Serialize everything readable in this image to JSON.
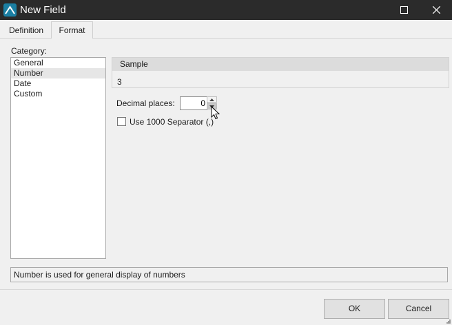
{
  "window": {
    "title": "New Field",
    "app_icon": "app-logo-icon",
    "maximize_icon": "maximize-icon",
    "close_icon": "close-icon"
  },
  "tabs": [
    {
      "label": "Definition",
      "active": false
    },
    {
      "label": "Format",
      "active": true
    }
  ],
  "category": {
    "label": "Category:",
    "items": [
      "General",
      "Number",
      "Date",
      "Custom"
    ],
    "selected": "Number"
  },
  "sample": {
    "header": "Sample",
    "value": "3"
  },
  "decimal_places": {
    "label": "Decimal places:",
    "value": "0"
  },
  "separator": {
    "label": "Use 1000 Separator (,)",
    "checked": false
  },
  "description": "Number is used for general display of numbers",
  "buttons": {
    "ok": "OK",
    "cancel": "Cancel"
  },
  "colors": {
    "titlebar": "#2b2b2b",
    "app_icon": "#1b7fa3",
    "background": "#f0f0f0",
    "selected_item": "#e6e6e6"
  }
}
